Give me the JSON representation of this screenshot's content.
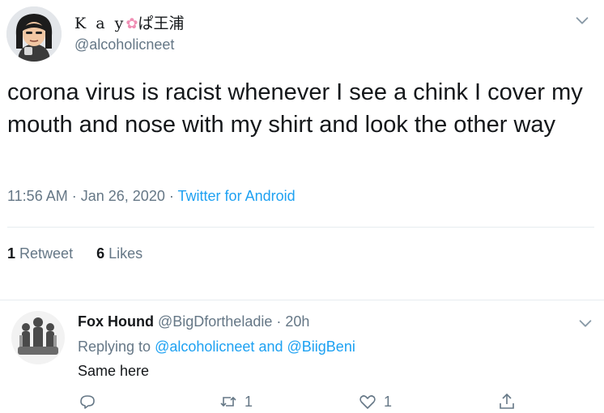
{
  "tweet": {
    "display_name": "K a y",
    "display_name_suffix": "ぱ王浦",
    "handle": "@alcoholicneet",
    "text": "corona virus is racist whenever I see a chink I cover my mouth and nose with my shirt and look the other way",
    "time": "11:56 AM",
    "separator": "·",
    "date": "Jan 26, 2020",
    "source": "Twitter for Android",
    "retweets_count": "1",
    "retweets_label": "Retweet",
    "likes_count": "6",
    "likes_label": "Likes"
  },
  "reply": {
    "name": "Fox Hound",
    "handle": "@BigDfortheladie",
    "separator": "·",
    "age": "20h",
    "replying_prefix": "Replying to",
    "replying_user1": "@alcoholicneet",
    "replying_and": "and",
    "replying_user2": "@BiigBeni",
    "text": "Same here",
    "retweet_count": "1",
    "like_count": "1"
  },
  "icons": {
    "caret": "chevron-down-icon",
    "flower": "cherry-blossom-icon",
    "reply": "reply-icon",
    "retweet": "retweet-icon",
    "like": "heart-icon",
    "share": "share-icon"
  },
  "colors": {
    "text": "#14171a",
    "muted": "#657786",
    "link": "#1da1f2",
    "divider": "#e6ecf0"
  }
}
